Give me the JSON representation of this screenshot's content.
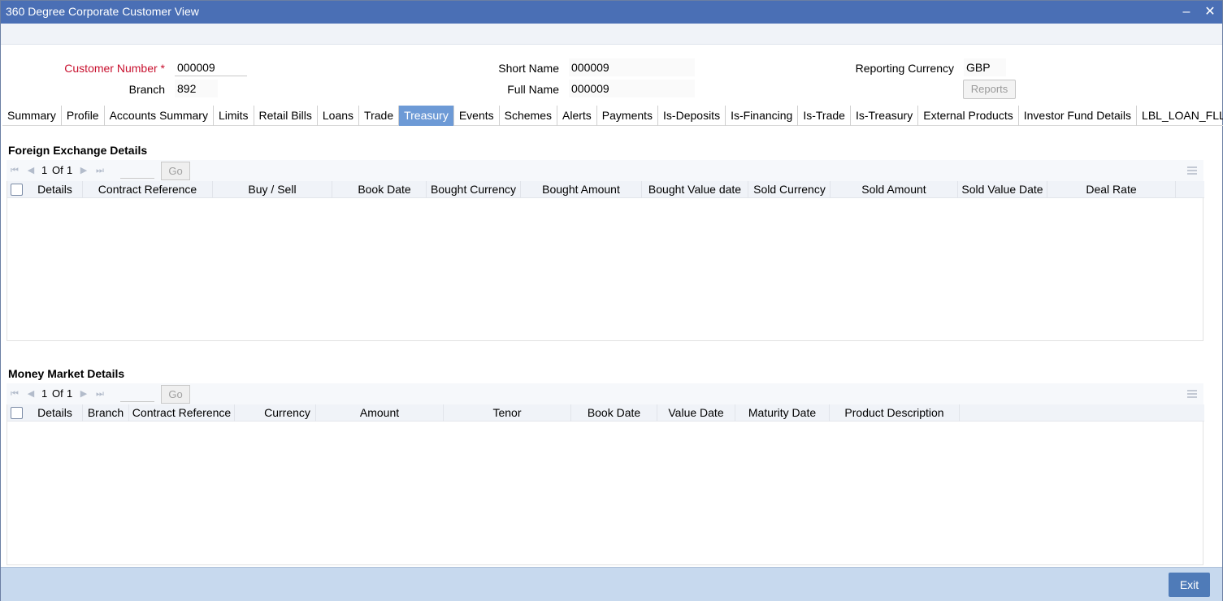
{
  "window": {
    "title": "360 Degree Corporate Customer View",
    "minimize_icon": "minimize-icon",
    "close_icon": "close-icon"
  },
  "header": {
    "customer_number_label": "Customer Number",
    "customer_number_required": "*",
    "customer_number_value": "000009",
    "branch_label": "Branch",
    "branch_value": "892",
    "short_name_label": "Short Name",
    "short_name_value": "000009",
    "full_name_label": "Full Name",
    "full_name_value": "000009",
    "reporting_currency_label": "Reporting Currency",
    "reporting_currency_value": "GBP",
    "reports_button": "Reports"
  },
  "tabs": [
    {
      "label": "Summary",
      "active": false
    },
    {
      "label": "Profile",
      "active": false
    },
    {
      "label": "Accounts Summary",
      "active": false
    },
    {
      "label": "Limits",
      "active": false
    },
    {
      "label": "Retail Bills",
      "active": false
    },
    {
      "label": "Loans",
      "active": false
    },
    {
      "label": "Trade",
      "active": false
    },
    {
      "label": "Treasury",
      "active": true
    },
    {
      "label": "Events",
      "active": false
    },
    {
      "label": "Schemes",
      "active": false
    },
    {
      "label": "Alerts",
      "active": false
    },
    {
      "label": "Payments",
      "active": false
    },
    {
      "label": "Is-Deposits",
      "active": false
    },
    {
      "label": "Is-Financing",
      "active": false
    },
    {
      "label": "Is-Trade",
      "active": false
    },
    {
      "label": "Is-Treasury",
      "active": false
    },
    {
      "label": "External Products",
      "active": false
    },
    {
      "label": "Investor Fund Details",
      "active": false
    },
    {
      "label": "LBL_LOAN_FLL",
      "active": false
    }
  ],
  "fx_section": {
    "title": "Foreign Exchange Details",
    "pager": {
      "current": "1",
      "of_label": "Of",
      "total": "1",
      "go_label": "Go"
    },
    "columns": [
      "Details",
      "Contract Reference",
      "Buy / Sell",
      "Book Date",
      "Bought Currency",
      "Bought Amount",
      "Bought Value date",
      "Sold Currency",
      "Sold Amount",
      "Sold Value Date",
      "Deal Rate"
    ]
  },
  "mm_section": {
    "title": "Money Market Details",
    "pager": {
      "current": "1",
      "of_label": "Of",
      "total": "1",
      "go_label": "Go"
    },
    "columns": [
      "Details",
      "Branch",
      "Contract Reference",
      "Currency",
      "Amount",
      "Tenor",
      "Book Date",
      "Value Date",
      "Maturity Date",
      "Product Description"
    ]
  },
  "footer": {
    "exit_button": "Exit"
  }
}
